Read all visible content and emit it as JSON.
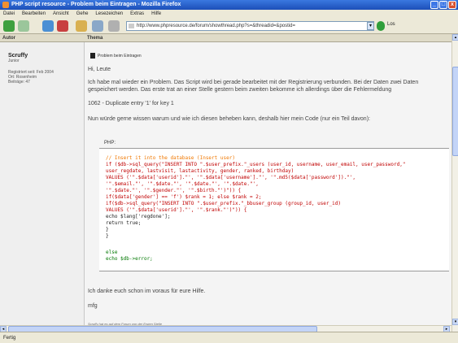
{
  "window": {
    "title": "PHP script resource - Problem beim Eintragen - Mozilla Firefox",
    "minimize": "_",
    "maximize": "□",
    "close": "x"
  },
  "menu": [
    "Datei",
    "Bearbeiten",
    "Ansicht",
    "Gehe",
    "Lesezeichen",
    "Extras",
    "Hilfe"
  ],
  "address": {
    "url": "http://www.phpresource.de/forum/showthread.php?s=&threadid=&postid=",
    "go_label": "Los"
  },
  "columns": {
    "author": "Autor",
    "topic": "Thema"
  },
  "author": {
    "name": "Scruffy",
    "rank": "Junior",
    "registered": "Registriert seit: Feb 2004",
    "location": "Ort: Rosenheim",
    "posts": "Beiträge: 47"
  },
  "post": {
    "subject": "Problem beim Eintragen",
    "greeting": "Hi, Leute",
    "line1": "Ich habe mal wieder ein Problem. Das Script wird bei gerade bearbeitet mit der Registrierung verbunden. Bei der Daten zwei Daten",
    "line2": "gespeichert werden. Das erste trat an einer Stelle gestern beim zweiten bekomme ich allerdings über die Fehlermeldung",
    "error": "1062 - Duplicate entry '1' for key 1",
    "question": "Nun würde gerne wissen warum und wie ich diesen beheben kann, deshalb hier mein Code (nur ein Teil davon):",
    "code_header": "PHP:",
    "code": [
      {
        "cls": "c-com",
        "text": "// Insert it into the database (Insert user)"
      },
      {
        "cls": "c-red",
        "text": "    if ($db->sql_query(\"INSERT INTO \".$user_prefix.\"_users (user_id, username, user_email, user_password,\""
      },
      {
        "cls": "c-red",
        "text": "user_regdate, lastvisit, lastactivity, gender, ranked, birthday)"
      },
      {
        "cls": "c-red",
        "text": "        VALUES ('\".$data['userid'].\"', '\".$data['username'].\"', '\".md5($data['password']).\"',"
      },
      {
        "cls": "c-red",
        "text": "    '\".$email.\"', '\".$date.\"', '\".$date.\"', '\".$date.\"',"
      },
      {
        "cls": "c-red",
        "text": "    '\".$date.\"', '\".$gender.\"', '\".$birth.\"')\")) {"
      },
      {
        "cls": "c-red",
        "text": "        if($data['gender'] == 'f') $rank = 1; else $rank = 2;"
      },
      {
        "cls": "c-red",
        "text": "        if($db->sql_query(\"INSERT INTO \".$user_prefix.\"_bbuser_group (group_id, user_id)"
      },
      {
        "cls": "c-red",
        "text": "  VALUES ('\".$data['userid'].\"', '\".$rank.\"')\")) {"
      },
      {
        "cls": "c-blk",
        "text": "                echo $lang['regdone'];"
      },
      {
        "cls": "c-blk",
        "text": "                return true;"
      },
      {
        "cls": "c-blk",
        "text": "            }"
      },
      {
        "cls": "c-blk",
        "text": "        }"
      },
      {
        "cls": "c-grn",
        "text": "        else"
      },
      {
        "cls": "c-grn",
        "text": "        echo $db->error;"
      }
    ],
    "thanks": "Ich danke euch schon im voraus für eure Hilfe.",
    "closing": "mfg",
    "signature": "Scruffy hat es auf dem Forum von der Ersten Stelle"
  },
  "status": "Fertig"
}
